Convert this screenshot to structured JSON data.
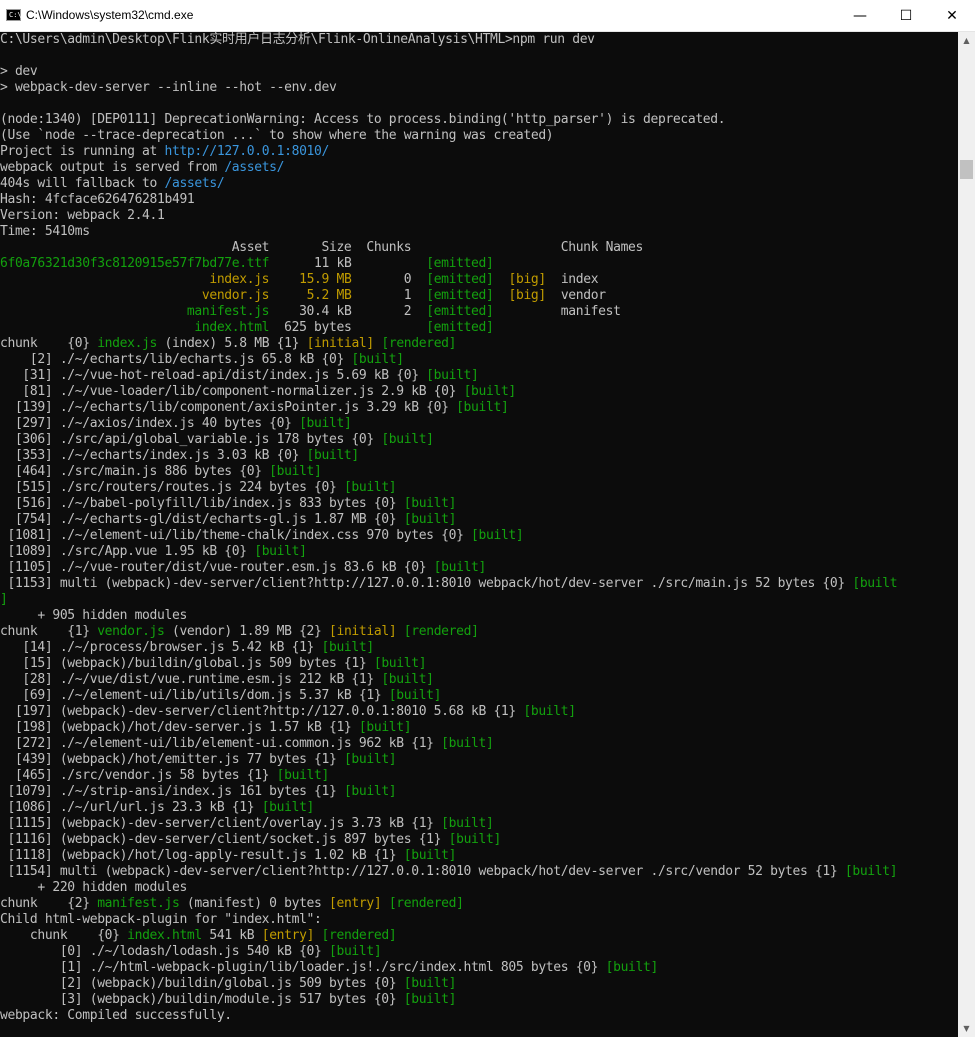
{
  "window": {
    "title": "C:\\Windows\\system32\\cmd.exe",
    "icon": "cmd-icon",
    "icon_text": "C:\\",
    "minimize": "—",
    "maximize": "☐",
    "close": "✕"
  },
  "colors": {
    "background": "#0c0c0c",
    "text": "#c0c0c0",
    "green": "#13a10e",
    "yellow": "#c19c00",
    "blue": "#3a96dd"
  },
  "lines": [
    [
      [
        "C:\\Users\\admin\\Desktop\\Flink实时用户日志分析\\Flink-OnlineAnalysis\\HTML>npm run dev",
        ""
      ]
    ],
    [],
    [
      [
        "> dev",
        ""
      ]
    ],
    [
      [
        "> webpack-dev-server --inline --hot --env.dev",
        ""
      ]
    ],
    [],
    [
      [
        "(node:1340) [DEP0111] DeprecationWarning: Access to process.binding('http_parser') is deprecated.",
        ""
      ]
    ],
    [
      [
        "(Use `node --trace-deprecation ...` to show where the warning was created)",
        ""
      ]
    ],
    [
      [
        "Project is running at ",
        ""
      ],
      [
        "http://127.0.0.1:8010/",
        "b"
      ]
    ],
    [
      [
        "webpack output is served from ",
        ""
      ],
      [
        "/assets/",
        "b"
      ]
    ],
    [
      [
        "404s will fallback to ",
        ""
      ],
      [
        "/assets/",
        "b"
      ]
    ],
    [
      [
        "Hash: 4fcface626476281b491",
        ""
      ]
    ],
    [
      [
        "Version: webpack 2.4.1",
        ""
      ]
    ],
    [
      [
        "Time: 5410ms",
        ""
      ]
    ],
    [
      [
        "                               Asset       Size  Chunks                    Chunk Names",
        ""
      ]
    ],
    [
      [
        "6f0a76321d30f3c8120915e57f7bd77e.ttf",
        "g"
      ],
      [
        "      11 kB          ",
        ""
      ],
      [
        "[emitted]",
        "g"
      ]
    ],
    [
      [
        "                            index.js",
        "y"
      ],
      [
        "    ",
        ""
      ],
      [
        "15.9 MB",
        "y"
      ],
      [
        "       0  ",
        ""
      ],
      [
        "[emitted]",
        "g"
      ],
      [
        "  ",
        ""
      ],
      [
        "[big]",
        "y"
      ],
      [
        "  index",
        ""
      ]
    ],
    [
      [
        "                           vendor.js",
        "y"
      ],
      [
        "     ",
        ""
      ],
      [
        "5.2 MB",
        "y"
      ],
      [
        "       1  ",
        ""
      ],
      [
        "[emitted]",
        "g"
      ],
      [
        "  ",
        ""
      ],
      [
        "[big]",
        "y"
      ],
      [
        "  vendor",
        ""
      ]
    ],
    [
      [
        "                         manifest.js",
        "g"
      ],
      [
        "    30.4 kB       2  ",
        ""
      ],
      [
        "[emitted]",
        "g"
      ],
      [
        "         manifest",
        ""
      ]
    ],
    [
      [
        "                          index.html",
        "g"
      ],
      [
        "  625 bytes          ",
        ""
      ],
      [
        "[emitted]",
        "g"
      ]
    ],
    [
      [
        "chunk    {0} ",
        ""
      ],
      [
        "index.js",
        "g"
      ],
      [
        " (index) 5.8 MB {1} ",
        ""
      ],
      [
        "[initial]",
        "y"
      ],
      [
        " ",
        ""
      ],
      [
        "[rendered]",
        "g"
      ]
    ],
    [
      [
        "    [2] ./~/echarts/lib/echarts.js 65.8 kB {0} ",
        ""
      ],
      [
        "[built]",
        "g"
      ]
    ],
    [
      [
        "   [31] ./~/vue-hot-reload-api/dist/index.js 5.69 kB {0} ",
        ""
      ],
      [
        "[built]",
        "g"
      ]
    ],
    [
      [
        "   [81] ./~/vue-loader/lib/component-normalizer.js 2.9 kB {0} ",
        ""
      ],
      [
        "[built]",
        "g"
      ]
    ],
    [
      [
        "  [139] ./~/echarts/lib/component/axisPointer.js 3.29 kB {0} ",
        ""
      ],
      [
        "[built]",
        "g"
      ]
    ],
    [
      [
        "  [297] ./~/axios/index.js 40 bytes {0} ",
        ""
      ],
      [
        "[built]",
        "g"
      ]
    ],
    [
      [
        "  [306] ./src/api/global_variable.js 178 bytes {0} ",
        ""
      ],
      [
        "[built]",
        "g"
      ]
    ],
    [
      [
        "  [353] ./~/echarts/index.js 3.03 kB {0} ",
        ""
      ],
      [
        "[built]",
        "g"
      ]
    ],
    [
      [
        "  [464] ./src/main.js 886 bytes {0} ",
        ""
      ],
      [
        "[built]",
        "g"
      ]
    ],
    [
      [
        "  [515] ./src/routers/routes.js 224 bytes {0} ",
        ""
      ],
      [
        "[built]",
        "g"
      ]
    ],
    [
      [
        "  [516] ./~/babel-polyfill/lib/index.js 833 bytes {0} ",
        ""
      ],
      [
        "[built]",
        "g"
      ]
    ],
    [
      [
        "  [754] ./~/echarts-gl/dist/echarts-gl.js 1.87 MB {0} ",
        ""
      ],
      [
        "[built]",
        "g"
      ]
    ],
    [
      [
        " [1081] ./~/element-ui/lib/theme-chalk/index.css 970 bytes {0} ",
        ""
      ],
      [
        "[built]",
        "g"
      ]
    ],
    [
      [
        " [1089] ./src/App.vue 1.95 kB {0} ",
        ""
      ],
      [
        "[built]",
        "g"
      ]
    ],
    [
      [
        " [1105] ./~/vue-router/dist/vue-router.esm.js 83.6 kB {0} ",
        ""
      ],
      [
        "[built]",
        "g"
      ]
    ],
    [
      [
        " [1153] multi (webpack)-dev-server/client?http://127.0.0.1:8010 webpack/hot/dev-server ./src/main.js 52 bytes {0} ",
        ""
      ],
      [
        "[built",
        "g"
      ]
    ],
    [
      [
        "]",
        "g"
      ]
    ],
    [
      [
        "     + 905 hidden modules",
        ""
      ]
    ],
    [
      [
        "chunk    {1} ",
        ""
      ],
      [
        "vendor.js",
        "g"
      ],
      [
        " (vendor) 1.89 MB {2} ",
        ""
      ],
      [
        "[initial]",
        "y"
      ],
      [
        " ",
        ""
      ],
      [
        "[rendered]",
        "g"
      ]
    ],
    [
      [
        "   [14] ./~/process/browser.js 5.42 kB {1} ",
        ""
      ],
      [
        "[built]",
        "g"
      ]
    ],
    [
      [
        "   [15] (webpack)/buildin/global.js 509 bytes {1} ",
        ""
      ],
      [
        "[built]",
        "g"
      ]
    ],
    [
      [
        "   [28] ./~/vue/dist/vue.runtime.esm.js 212 kB {1} ",
        ""
      ],
      [
        "[built]",
        "g"
      ]
    ],
    [
      [
        "   [69] ./~/element-ui/lib/utils/dom.js 5.37 kB {1} ",
        ""
      ],
      [
        "[built]",
        "g"
      ]
    ],
    [
      [
        "  [197] (webpack)-dev-server/client?http://127.0.0.1:8010 5.68 kB {1} ",
        ""
      ],
      [
        "[built]",
        "g"
      ]
    ],
    [
      [
        "  [198] (webpack)/hot/dev-server.js 1.57 kB {1} ",
        ""
      ],
      [
        "[built]",
        "g"
      ]
    ],
    [
      [
        "  [272] ./~/element-ui/lib/element-ui.common.js 962 kB {1} ",
        ""
      ],
      [
        "[built]",
        "g"
      ]
    ],
    [
      [
        "  [439] (webpack)/hot/emitter.js 77 bytes {1} ",
        ""
      ],
      [
        "[built]",
        "g"
      ]
    ],
    [
      [
        "  [465] ./src/vendor.js 58 bytes {1} ",
        ""
      ],
      [
        "[built]",
        "g"
      ]
    ],
    [
      [
        " [1079] ./~/strip-ansi/index.js 161 bytes {1} ",
        ""
      ],
      [
        "[built]",
        "g"
      ]
    ],
    [
      [
        " [1086] ./~/url/url.js 23.3 kB {1} ",
        ""
      ],
      [
        "[built]",
        "g"
      ]
    ],
    [
      [
        " [1115] (webpack)-dev-server/client/overlay.js 3.73 kB {1} ",
        ""
      ],
      [
        "[built]",
        "g"
      ]
    ],
    [
      [
        " [1116] (webpack)-dev-server/client/socket.js 897 bytes {1} ",
        ""
      ],
      [
        "[built]",
        "g"
      ]
    ],
    [
      [
        " [1118] (webpack)/hot/log-apply-result.js 1.02 kB {1} ",
        ""
      ],
      [
        "[built]",
        "g"
      ]
    ],
    [
      [
        " [1154] multi (webpack)-dev-server/client?http://127.0.0.1:8010 webpack/hot/dev-server ./src/vendor 52 bytes {1} ",
        ""
      ],
      [
        "[built]",
        "g"
      ]
    ],
    [
      [
        "     + 220 hidden modules",
        ""
      ]
    ],
    [
      [
        "chunk    {2} ",
        ""
      ],
      [
        "manifest.js",
        "g"
      ],
      [
        " (manifest) 0 bytes ",
        ""
      ],
      [
        "[entry]",
        "y"
      ],
      [
        " ",
        ""
      ],
      [
        "[rendered]",
        "g"
      ]
    ],
    [
      [
        "Child html-webpack-plugin for \"index.html\":",
        ""
      ]
    ],
    [
      [
        "    chunk    {0} ",
        ""
      ],
      [
        "index.html",
        "g"
      ],
      [
        " 541 kB ",
        ""
      ],
      [
        "[entry]",
        "y"
      ],
      [
        " ",
        ""
      ],
      [
        "[rendered]",
        "g"
      ]
    ],
    [
      [
        "        [0] ./~/lodash/lodash.js 540 kB {0} ",
        ""
      ],
      [
        "[built]",
        "g"
      ]
    ],
    [
      [
        "        [1] ./~/html-webpack-plugin/lib/loader.js!./src/index.html 805 bytes {0} ",
        ""
      ],
      [
        "[built]",
        "g"
      ]
    ],
    [
      [
        "        [2] (webpack)/buildin/global.js 509 bytes {0} ",
        ""
      ],
      [
        "[built]",
        "g"
      ]
    ],
    [
      [
        "        [3] (webpack)/buildin/module.js 517 bytes {0} ",
        ""
      ],
      [
        "[built]",
        "g"
      ]
    ],
    [
      [
        "webpack: Compiled successfully.",
        ""
      ]
    ]
  ]
}
